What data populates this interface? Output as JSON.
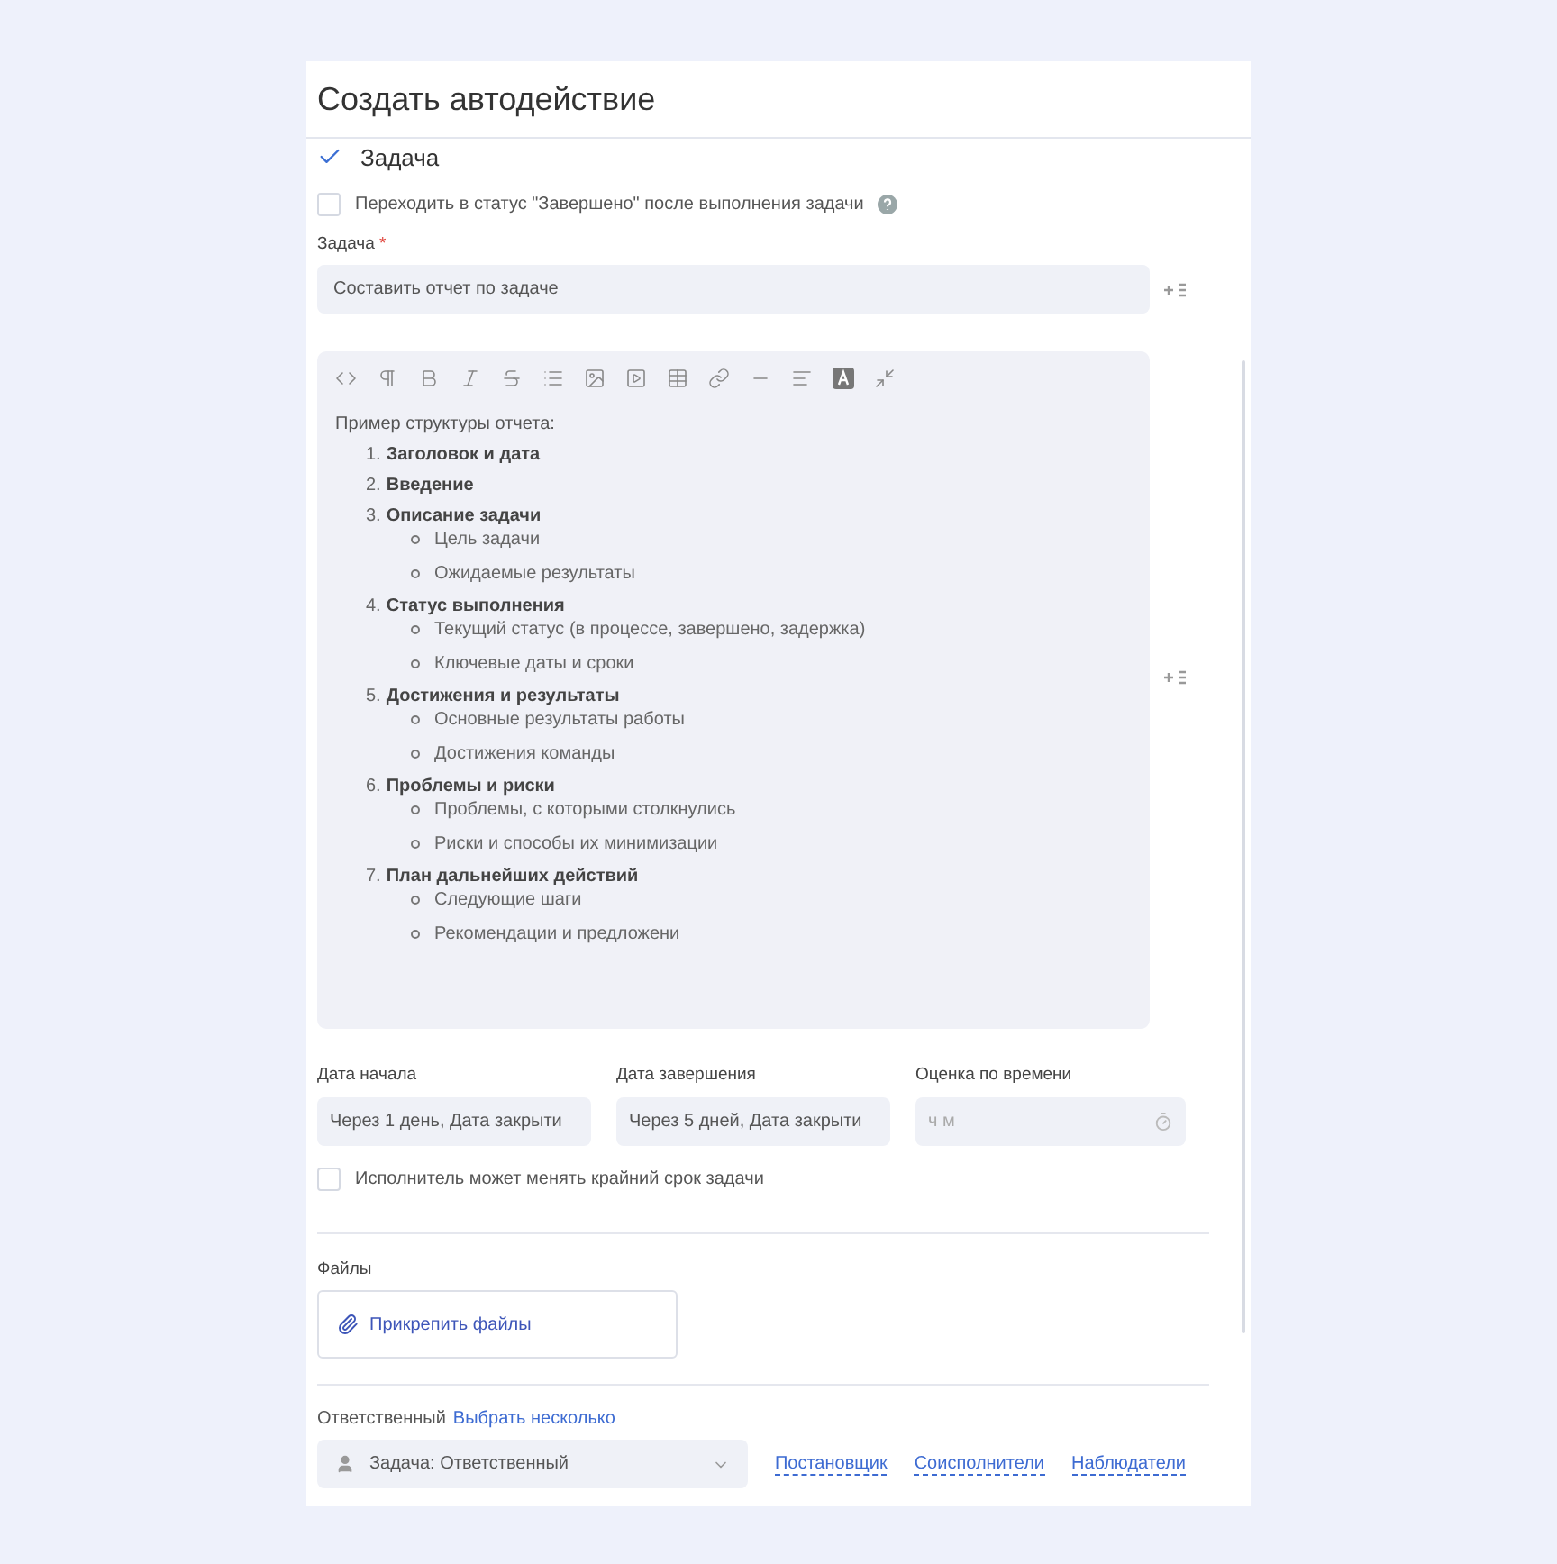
{
  "title": "Создать автодействие",
  "section": {
    "title": "Задача",
    "checked": true
  },
  "complete_checkbox": {
    "label": "Переходить в статус \"Завершено\" после выполнения задачи",
    "checked": false
  },
  "task_field": {
    "label": "Задача",
    "required_mark": "*",
    "value": "Составить отчет по задаче"
  },
  "editor": {
    "toolbar": [
      {
        "kind": "code"
      },
      {
        "kind": "paragraph"
      },
      {
        "kind": "bold"
      },
      {
        "kind": "italic"
      },
      {
        "kind": "strike"
      },
      {
        "kind": "list"
      },
      {
        "kind": "image"
      },
      {
        "kind": "video"
      },
      {
        "kind": "table"
      },
      {
        "kind": "link"
      },
      {
        "kind": "rule"
      },
      {
        "kind": "align"
      },
      {
        "kind": "color"
      },
      {
        "kind": "collapse"
      }
    ],
    "intro": "Пример структуры отчета:",
    "items": [
      {
        "marker": "1.",
        "title": "Заголовок и дата"
      },
      {
        "marker": "2.",
        "title": "Введение"
      },
      {
        "marker": "3.",
        "title": "Описание задачи",
        "children": [
          "Цель задачи",
          "Ожидаемые результаты"
        ]
      },
      {
        "marker": "4.",
        "title": "Статус выполнения",
        "children": [
          "Текущий статус (в процессе, завершено, задержка)",
          "Ключевые даты и сроки"
        ]
      },
      {
        "marker": "5.",
        "title": "Достижения и результаты",
        "children": [
          "Основные результаты работы",
          "Достижения команды"
        ]
      },
      {
        "marker": "6.",
        "title": "Проблемы и риски",
        "children": [
          "Проблемы, с которыми столкнулись",
          "Риски и способы их минимизации"
        ]
      },
      {
        "marker": "7.",
        "title": "План дальнейших действий",
        "children": [
          "Следующие шаги",
          "Рекомендации и предложени"
        ]
      }
    ]
  },
  "dates": [
    {
      "kind": "text",
      "label": "Дата начала",
      "value": "Через 1 день, Дата закрыти"
    },
    {
      "kind": "text",
      "label": "Дата завершения",
      "value": "Через 5 дней, Дата закрыти"
    },
    {
      "kind": "duration",
      "label": "Оценка по времени",
      "placeholder": "ч м"
    }
  ],
  "deadline_checkbox": {
    "label": "Исполнитель может менять крайний срок задачи",
    "checked": false
  },
  "files": {
    "label": "Файлы",
    "button": "Прикрепить файлы"
  },
  "responsible": {
    "label": "Ответственный",
    "link": "Выбрать несколько",
    "select": "Задача: Ответственный",
    "links": [
      "Постановщик",
      "Соисполнители",
      "Наблюдатели"
    ]
  }
}
